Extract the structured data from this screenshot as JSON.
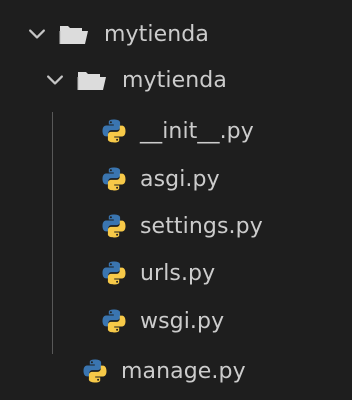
{
  "explorer": {
    "root_folder": {
      "label": "mytienda",
      "expanded": true
    },
    "sub_folder": {
      "label": "mytienda",
      "expanded": true
    },
    "sub_files": [
      {
        "label": "__init__.py",
        "icon": "python-file-icon"
      },
      {
        "label": "asgi.py",
        "icon": "python-file-icon"
      },
      {
        "label": "settings.py",
        "icon": "python-file-icon"
      },
      {
        "label": "urls.py",
        "icon": "python-file-icon"
      },
      {
        "label": "wsgi.py",
        "icon": "python-file-icon"
      }
    ],
    "root_files": [
      {
        "label": "manage.py",
        "icon": "python-file-icon"
      }
    ]
  },
  "theme": {
    "background": "#1e1e1e",
    "text": "#cccccc",
    "python_blue": "#3a75b0",
    "python_yellow": "#f7c948",
    "folder_color": "#dcdcdc"
  }
}
